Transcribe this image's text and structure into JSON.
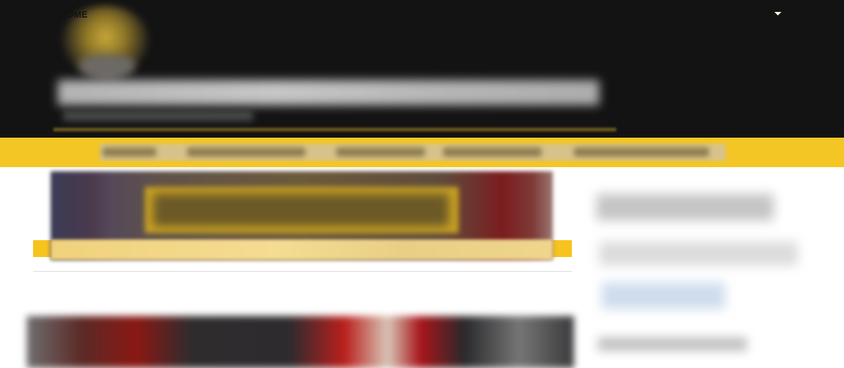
{
  "navigation": {
    "home_label": "HOME",
    "about_label": "ABOUT"
  },
  "colors": {
    "header_bg": "#141314",
    "accent": "#f4c625"
  },
  "icons": {
    "about_dropdown": "chevron-down-icon"
  }
}
